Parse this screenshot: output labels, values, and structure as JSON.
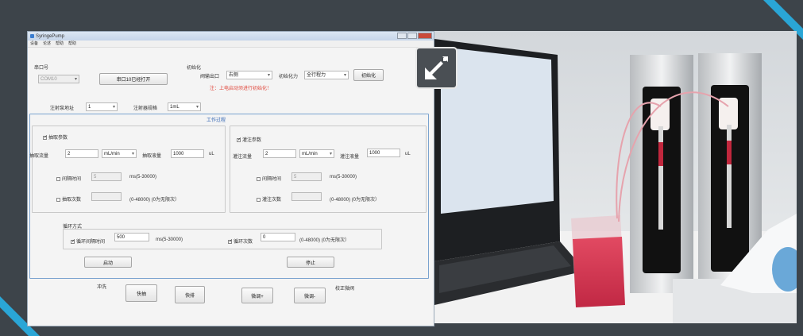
{
  "app": {
    "title": "SyringePump",
    "menu": [
      "设备",
      "论述",
      "帮助",
      "帮助"
    ],
    "serial": {
      "label": "串口号",
      "port_value": "COM10",
      "open_button": "串口10已经打开"
    },
    "init": {
      "group_label": "初始化",
      "valve_label": "阀输出口",
      "valve_value": "右侧",
      "force_label": "初始化力",
      "force_value": "全行程力",
      "init_button": "初始化",
      "warning": "注：上电启动须进行初始化！"
    },
    "pump": {
      "address_label": "注射泵地址",
      "address_value": "1",
      "spec_label": "注射器规格",
      "spec_value": "1mL"
    },
    "work": {
      "title": "工作过程",
      "aspirate": {
        "check_label": "抽取参数",
        "flow_label": "抽取流量",
        "flow_value": "2",
        "flow_unit": "mL/min",
        "volume_label": "抽取液量",
        "volume_value": "1000",
        "volume_unit": "uL",
        "interval_label": "间隔时间",
        "interval_value": "5",
        "interval_range": "ms(5-30000)",
        "count_label": "抽取次数",
        "count_range": "(0-48000) (0为无限次）"
      },
      "infuse": {
        "check_label": "灌注参数",
        "flow_label": "灌注流量",
        "flow_value": "2",
        "flow_unit": "mL/min",
        "volume_label": "灌注液量",
        "volume_value": "1000",
        "volume_unit": "uL",
        "interval_label": "间隔时间",
        "interval_value": "5",
        "interval_range": "ms(5-30000)",
        "count_label": "灌注次数",
        "count_range": "(0-48000) (0为无限次）"
      },
      "loop": {
        "group_label": "循环方式",
        "interval_label": "循环间隔时间",
        "interval_value": "500",
        "interval_range": "ms(5-30000)",
        "count_label": "循环次数",
        "count_value": "0",
        "count_range": "(0-48000) (0为无限次）"
      },
      "start_button": "启动",
      "stop_button": "停止"
    },
    "flush": {
      "label": "冲洗",
      "fast_pull": "快抽",
      "fast_push": "快排"
    },
    "calibrate": {
      "label": "校正微阀",
      "fine_plus": "微调+",
      "fine_minus": "微调-"
    }
  },
  "colors": {
    "frame": "#3d444a",
    "accent": "#2aa6d6",
    "warning": "#e0453a",
    "liquid": "#d9344f"
  }
}
